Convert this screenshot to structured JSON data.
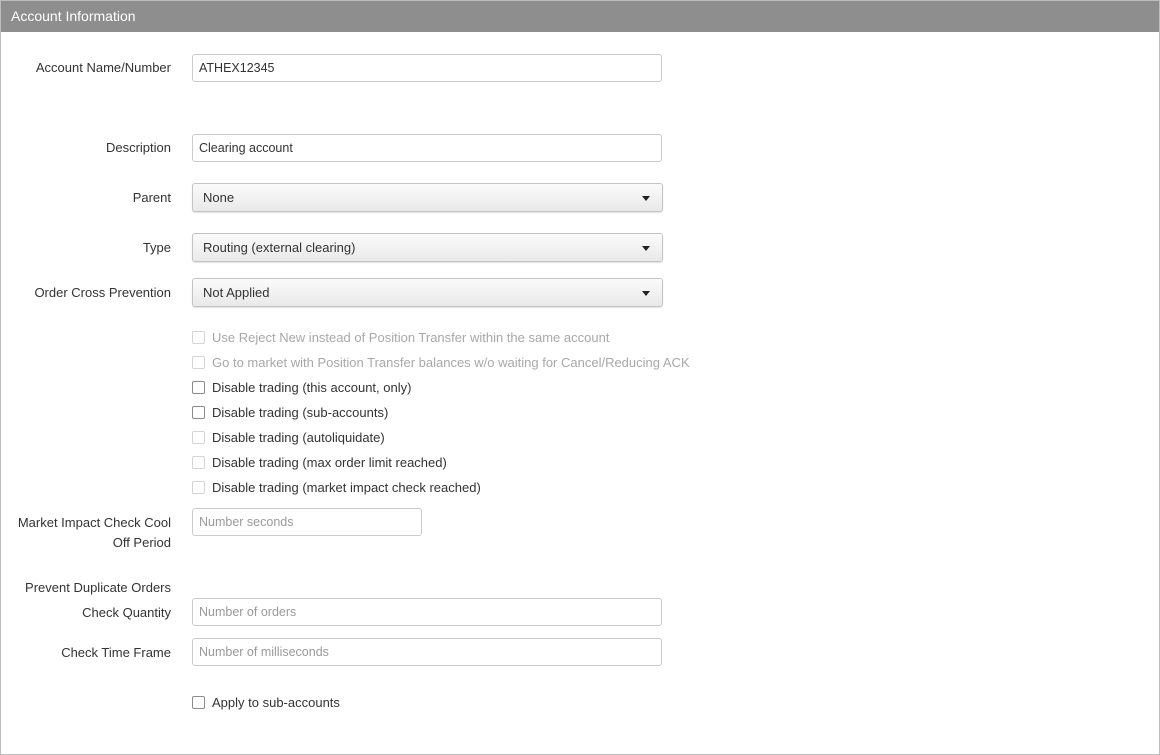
{
  "header": {
    "title": "Account Information"
  },
  "account_name": {
    "label": "Account Name/Number",
    "value": "ATHEX12345"
  },
  "description": {
    "label": "Description",
    "value": "Clearing account"
  },
  "parent": {
    "label": "Parent",
    "selected": "None"
  },
  "type": {
    "label": "Type",
    "selected": "Routing (external clearing)"
  },
  "order_cross_prevention": {
    "label": "Order Cross Prevention",
    "selected": "Not Applied"
  },
  "options": [
    {
      "label": "Use Reject New instead of Position Transfer within the same account",
      "checked": false,
      "disabled": true
    },
    {
      "label": "Go to market with Position Transfer balances w/o waiting for Cancel/Reducing ACK",
      "checked": false,
      "disabled": true
    },
    {
      "label": "Disable trading (this account, only)",
      "checked": false,
      "disabled": false
    },
    {
      "label": "Disable trading (sub-accounts)",
      "checked": false,
      "disabled": false
    },
    {
      "label": "Disable trading (autoliquidate)",
      "checked": false,
      "disabled": true
    },
    {
      "label": "Disable trading (max order limit reached)",
      "checked": false,
      "disabled": true
    },
    {
      "label": "Disable trading (market impact check reached)",
      "checked": false,
      "disabled": true
    }
  ],
  "market_impact": {
    "label": "Market Impact Check Cool Off Period",
    "value": "",
    "placeholder": "Number seconds"
  },
  "prevent_duplicates": {
    "section_label": "Prevent Duplicate Orders"
  },
  "check_quantity": {
    "label": "Check Quantity",
    "value": "",
    "placeholder": "Number of orders"
  },
  "check_time_frame": {
    "label": "Check Time Frame",
    "value": "",
    "placeholder": "Number of milliseconds"
  },
  "apply_sub_accounts": {
    "label": "Apply to sub-accounts",
    "checked": false,
    "disabled": false
  },
  "colors": {
    "header_bg": "#8e8e8e",
    "header_text": "#ffffff",
    "disabled_text": "#a8a8a8"
  }
}
